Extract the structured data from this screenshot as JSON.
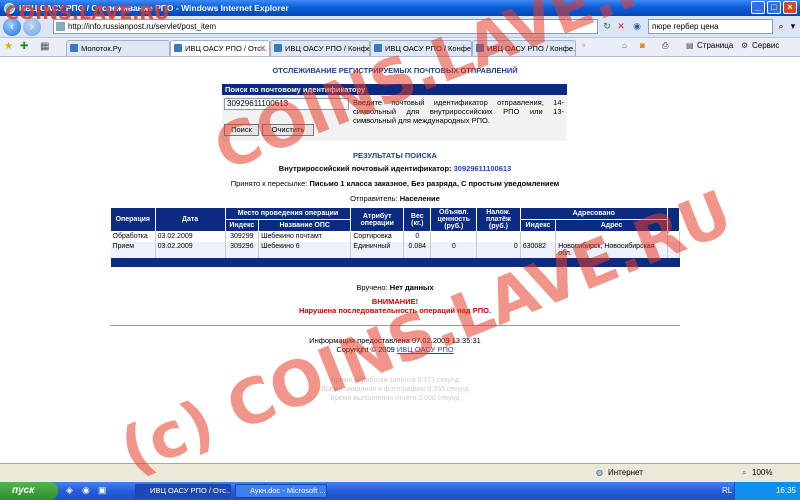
{
  "window": {
    "title": "ИВЦ ОАСУ РПО / Отслеживание РПО - Windows Internet Explorer"
  },
  "browser": {
    "url": "http://info.russianpost.ru/servlet/post_item",
    "search_value": "пюре гербер цена",
    "tabs": [
      {
        "label": "Молоток.Ру",
        "active": false
      },
      {
        "label": "ИВЦ ОАСУ РПО / Отс...",
        "active": true
      },
      {
        "label": "ИВЦ ОАСУ РПО / Конфе...",
        "active": false
      },
      {
        "label": "ИВЦ ОАСУ РПО / Конфе...",
        "active": false
      },
      {
        "label": "ИВЦ ОАСУ РПО / Конфе...",
        "active": false
      }
    ],
    "page_menu": "Страница",
    "tools_menu": "Сервис"
  },
  "page": {
    "title": "ОТСЛЕЖИВАНИЕ РЕГИСТРИРУЕМЫХ ПОЧТОВЫХ ОТПРАВЛЕНИЙ",
    "search": {
      "header": "Поиск по почтовому идентификатору",
      "value": "30929611100613",
      "help": "Введите почтовый идентификатор отправления, 14-символьный для внутрироссийских РПО или 13-символьный для международных РПО.",
      "search_button": "Поиск",
      "clear_button": "Очистить"
    },
    "results_title": "РЕЗУЛЬТАТЫ ПОИСКА",
    "id_label": "Внутрироссийский почтовый идентификатор:",
    "id_value": "30929611100613",
    "accepted_label": "Принято к пересылке:",
    "accepted_value": "Письмо 1 класса заказное, Без разряда, С простым уведомлением",
    "sender_label": "Отправитель:",
    "sender_value": "Население",
    "table": {
      "headers": {
        "operation": "Операция",
        "date": "Дата",
        "place": "Место проведения операции",
        "index": "Индекс",
        "ops_name": "Название ОПС",
        "attribute": "Атрибут операции",
        "weight": "Вес (кг.)",
        "declared": "Объявл. ценность (руб.)",
        "cod": "Налож. платёж (руб.)",
        "addressed": "Адресовано",
        "addr_index": "Индекс",
        "address": "Адрес"
      },
      "rows": [
        {
          "operation": "Обработка",
          "date": "03.02.2009",
          "index": "309299",
          "ops": "Шебекино почтамт",
          "attribute": "Сортировка",
          "weight": "0",
          "declared": "",
          "cod": "",
          "to_index": "",
          "address": ""
        },
        {
          "operation": "Прием",
          "date": "03.02.2009",
          "index": "309296",
          "ops": "Шебекино 6",
          "attribute": "Единичный",
          "weight": "0.084",
          "declared": "0",
          "cod": "0",
          "to_index": "630082",
          "address": "Новосибирск, Новосибирская обл."
        }
      ]
    },
    "delivered_label": "Вручено:",
    "delivered_value": "Нет данных",
    "warning_title": "ВНИМАНИЕ!",
    "warning_text": "Нарушена последовательность операций над РПО.",
    "info_line": "Информация предоставлена 07.02.2009 13:35:31",
    "copyright_prefix": "Copyright © 2009",
    "copyright_link": "ИВЦ ОАСУ РПО",
    "timing": [
      "Время обработки запроса 0.171 секунд",
      "Время ожидания в фотографию 0.155 секунд",
      "Время выполнения отчета 0.000 секунд"
    ]
  },
  "statusbar": {
    "zone": "Интернет",
    "zoom": "100%"
  },
  "taskbar": {
    "start": "пуск",
    "windows": [
      {
        "label": "ИВЦ ОАСУ РПО / Отс...",
        "active": true
      },
      {
        "label": "Аукн.doc - Microsoft ...",
        "active": false
      }
    ],
    "lang": "RL",
    "clock": "16:35"
  },
  "watermark": {
    "top": "COINS.LAVE.RU",
    "diag1": "COINS.LAVE.RU",
    "diag2": "(c) COINS.LAVE.RU"
  },
  "colors": {
    "header_blue": "#0b2a82",
    "title_blue": "#1f3f8f",
    "warning_red": "#cc0000",
    "watermark_red": "#e63c28"
  }
}
